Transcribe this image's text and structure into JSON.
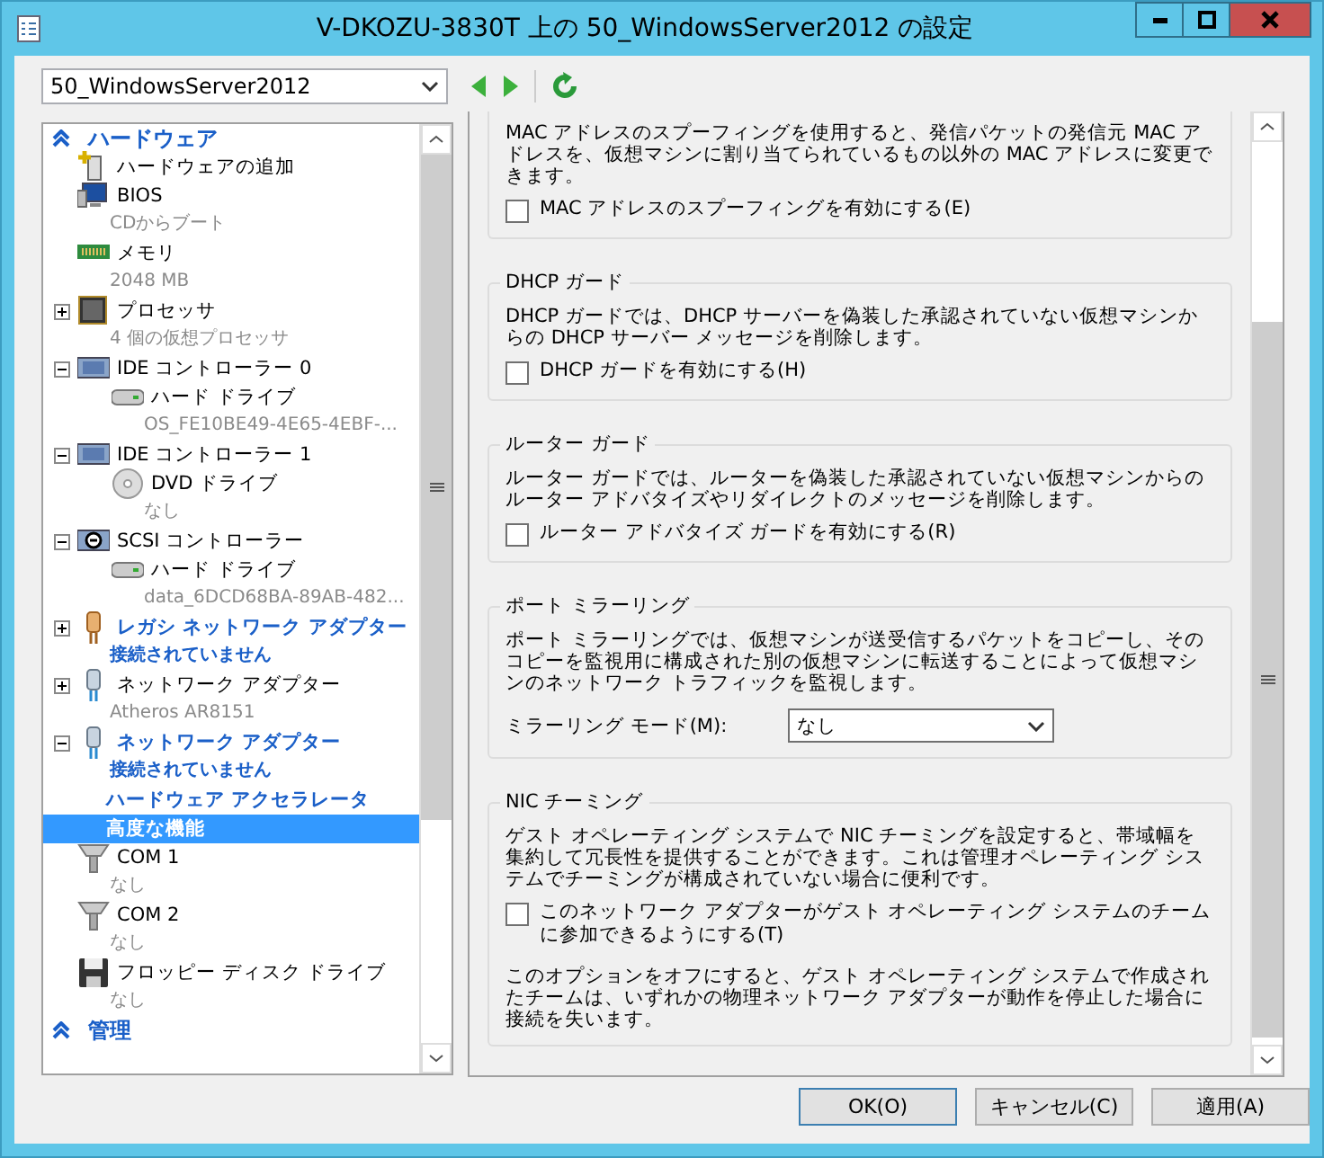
{
  "window": {
    "title": "V-DKOZU-3830T 上の 50_WindowsServer2012 の設定"
  },
  "toolbar": {
    "vm_select": {
      "value": "50_WindowsServer2012"
    }
  },
  "tree": [
    {
      "kind": "header",
      "label": "ハードウェア",
      "expanded": true,
      "children": [
        {
          "kind": "add",
          "label": "ハードウェアの追加",
          "selected": false
        },
        {
          "kind": "bios",
          "label": "BIOS",
          "detail": "CDからブート",
          "selected": false
        },
        {
          "kind": "memory",
          "label": "メモリ",
          "detail": "2048 MB",
          "selected": false
        },
        {
          "kind": "cpu",
          "label": "プロセッサ",
          "detail": "4 個の仮想プロセッサ",
          "expanded": false,
          "selected": false
        },
        {
          "kind": "controller",
          "label": "IDE コントローラー 0",
          "expanded": true,
          "selected": false,
          "children": [
            {
              "kind": "disk",
              "label": "ハード ドライブ",
              "detail": "OS_FE10BE49-4E65-4EBF-...",
              "selected": false
            }
          ]
        },
        {
          "kind": "controller",
          "label": "IDE コントローラー 1",
          "expanded": true,
          "selected": false,
          "children": [
            {
              "kind": "dvd",
              "label": "DVD ドライブ",
              "detail": "なし",
              "selected": false
            }
          ]
        },
        {
          "kind": "scsi",
          "label": "SCSI コントローラー",
          "expanded": true,
          "selected": false,
          "children": [
            {
              "kind": "disk",
              "label": "ハード ドライブ",
              "detail": "data_6DCD68BA-89AB-482...",
              "selected": false
            }
          ]
        },
        {
          "kind": "nic-legacy",
          "label": "レガシ ネットワーク アダプター",
          "detail": "接続されていません",
          "emphasized": true,
          "expanded": false,
          "selected": false
        },
        {
          "kind": "nic",
          "label": "ネットワーク アダプター",
          "detail": "Atheros AR8151",
          "emphasized": false,
          "expanded": false,
          "selected": false
        },
        {
          "kind": "nic",
          "label": "ネットワーク アダプター",
          "detail": "接続されていません",
          "emphasized": true,
          "expanded": true,
          "selected": false,
          "children": [
            {
              "kind": "sub",
              "label": "ハードウェア アクセラレータ",
              "emphasized": true,
              "selected": false
            },
            {
              "kind": "sub",
              "label": "高度な機能",
              "emphasized": true,
              "selected": true
            }
          ]
        },
        {
          "kind": "com",
          "label": "COM 1",
          "detail": "なし",
          "selected": false
        },
        {
          "kind": "com",
          "label": "COM 2",
          "detail": "なし",
          "selected": false
        },
        {
          "kind": "floppy",
          "label": "フロッピー ディスク ドライブ",
          "detail": "なし",
          "selected": false
        }
      ]
    },
    {
      "kind": "header",
      "label": "管理",
      "expanded": true
    }
  ],
  "sections": [
    {
      "paragraphs": [
        "MAC アドレスのスプーフィングを使用すると、発信パケットの発信元 MAC アドレスを、仮想マシンに割り当てられているもの以外の MAC アドレスに変更できます。"
      ],
      "checkbox": {
        "label": "MAC アドレスのスプーフィングを有効にする(E)",
        "checked": false
      }
    },
    {
      "title": "DHCP ガード",
      "paragraphs": [
        "DHCP ガードでは、DHCP サーバーを偽装した承認されていない仮想マシンからの DHCP サーバー メッセージを削除します。"
      ],
      "checkbox": {
        "label": "DHCP ガードを有効にする(H)",
        "checked": false
      }
    },
    {
      "title": "ルーター ガード",
      "paragraphs": [
        "ルーター ガードでは、ルーターを偽装した承認されていない仮想マシンからのルーター アドバタイズやリダイレクトのメッセージを削除します。"
      ],
      "checkbox": {
        "label": "ルーター アドバタイズ ガードを有効にする(R)",
        "checked": false
      }
    },
    {
      "title": "ポート ミラーリング",
      "paragraphs": [
        "ポート ミラーリングでは、仮想マシンが送受信するパケットをコピーし、そのコピーを監視用に構成された別の仮想マシンに転送することによって仮想マシンのネットワーク トラフィックを監視します。"
      ],
      "select": {
        "label": "ミラーリング モード(M):",
        "value": "なし"
      }
    },
    {
      "title": "NIC チーミング",
      "paragraphs": [
        "ゲスト オペレーティング システムで NIC チーミングを設定すると、帯域幅を集約して冗長性を提供することができます。これは管理オペレーティング システムでチーミングが構成されていない場合に便利です。"
      ],
      "checkbox": {
        "label": "このネットワーク アダプターがゲスト オペレーティング システムのチームに参加できるようにする(T)",
        "checked": false
      },
      "note": "このオプションをオフにすると、ゲスト オペレーティング システムで作成されたチームは、いずれかの物理ネットワーク アダプターが動作を停止した場合に接続を失います。"
    }
  ],
  "buttons": [
    {
      "label": "OK(O)",
      "default": true
    },
    {
      "label": "キャンセル(C)",
      "default": false
    },
    {
      "label": "適用(A)",
      "default": false
    }
  ]
}
